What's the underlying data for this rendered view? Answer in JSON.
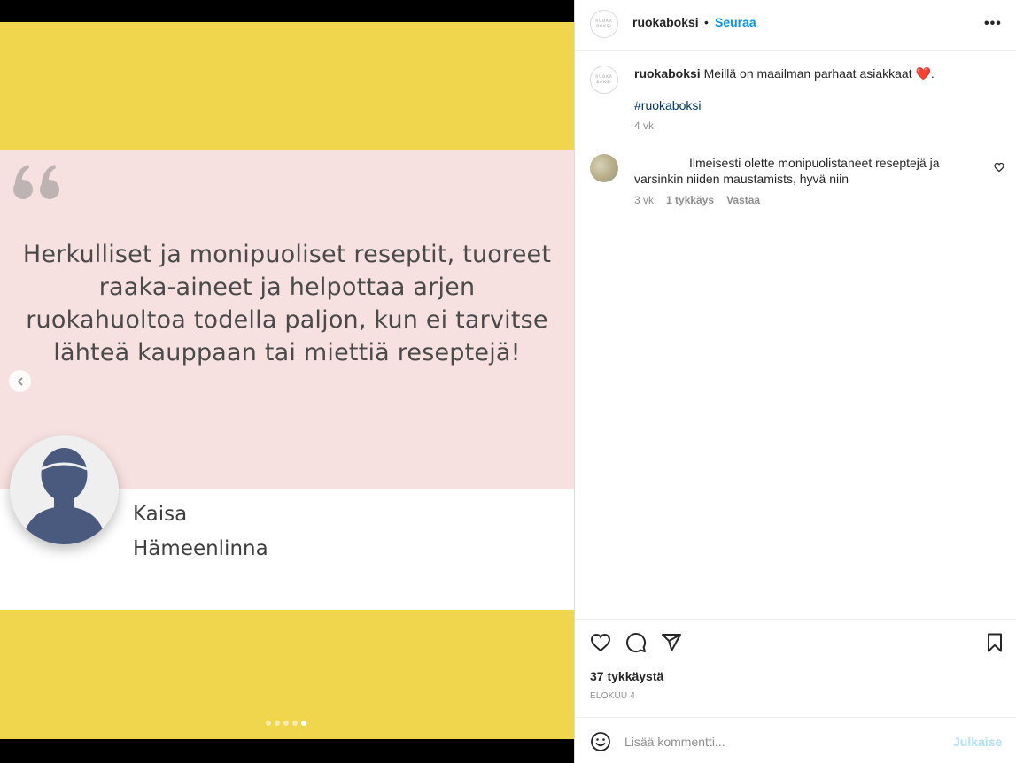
{
  "media": {
    "quote_text": "Herkulliset ja monipuoliset reseptit, tuoreet raaka-aineet ja helpottaa arjen ruokahuoltoa todella paljon, kun ei tarvitse lähteä kauppaan tai miettiä reseptejä!",
    "person_name": "Kaisa",
    "person_city": "Hämeenlinna",
    "slide_count": 5,
    "active_slide": 5,
    "colors": {
      "yellow": "#f0d64c",
      "pink": "#f6e1e0",
      "silhouette": "#4a5a7e"
    }
  },
  "header": {
    "logo_text": "RUOKA BOKSI",
    "username": "ruokaboksi",
    "separator": "•",
    "follow_label": "Seuraa",
    "more_icon": "more-horizontal-icon"
  },
  "caption": {
    "username": "ruokaboksi",
    "text": "Meillä on maailman parhaat asiakkaat ❤️.",
    "hashtag": "#ruokaboksi",
    "time": "4 vk"
  },
  "comment": {
    "text": "Ilmeisesti olette monipuolistaneet reseptejä ja varsinkin niiden maustamists, hyvä niin",
    "time": "3 vk",
    "likes": "1 tykkäys",
    "reply": "Vastaa"
  },
  "footer": {
    "likes": "37 tykkäystä",
    "date": "ELOKUU 4",
    "comment_placeholder": "Lisää kommentti...",
    "post_label": "Julkaise"
  }
}
